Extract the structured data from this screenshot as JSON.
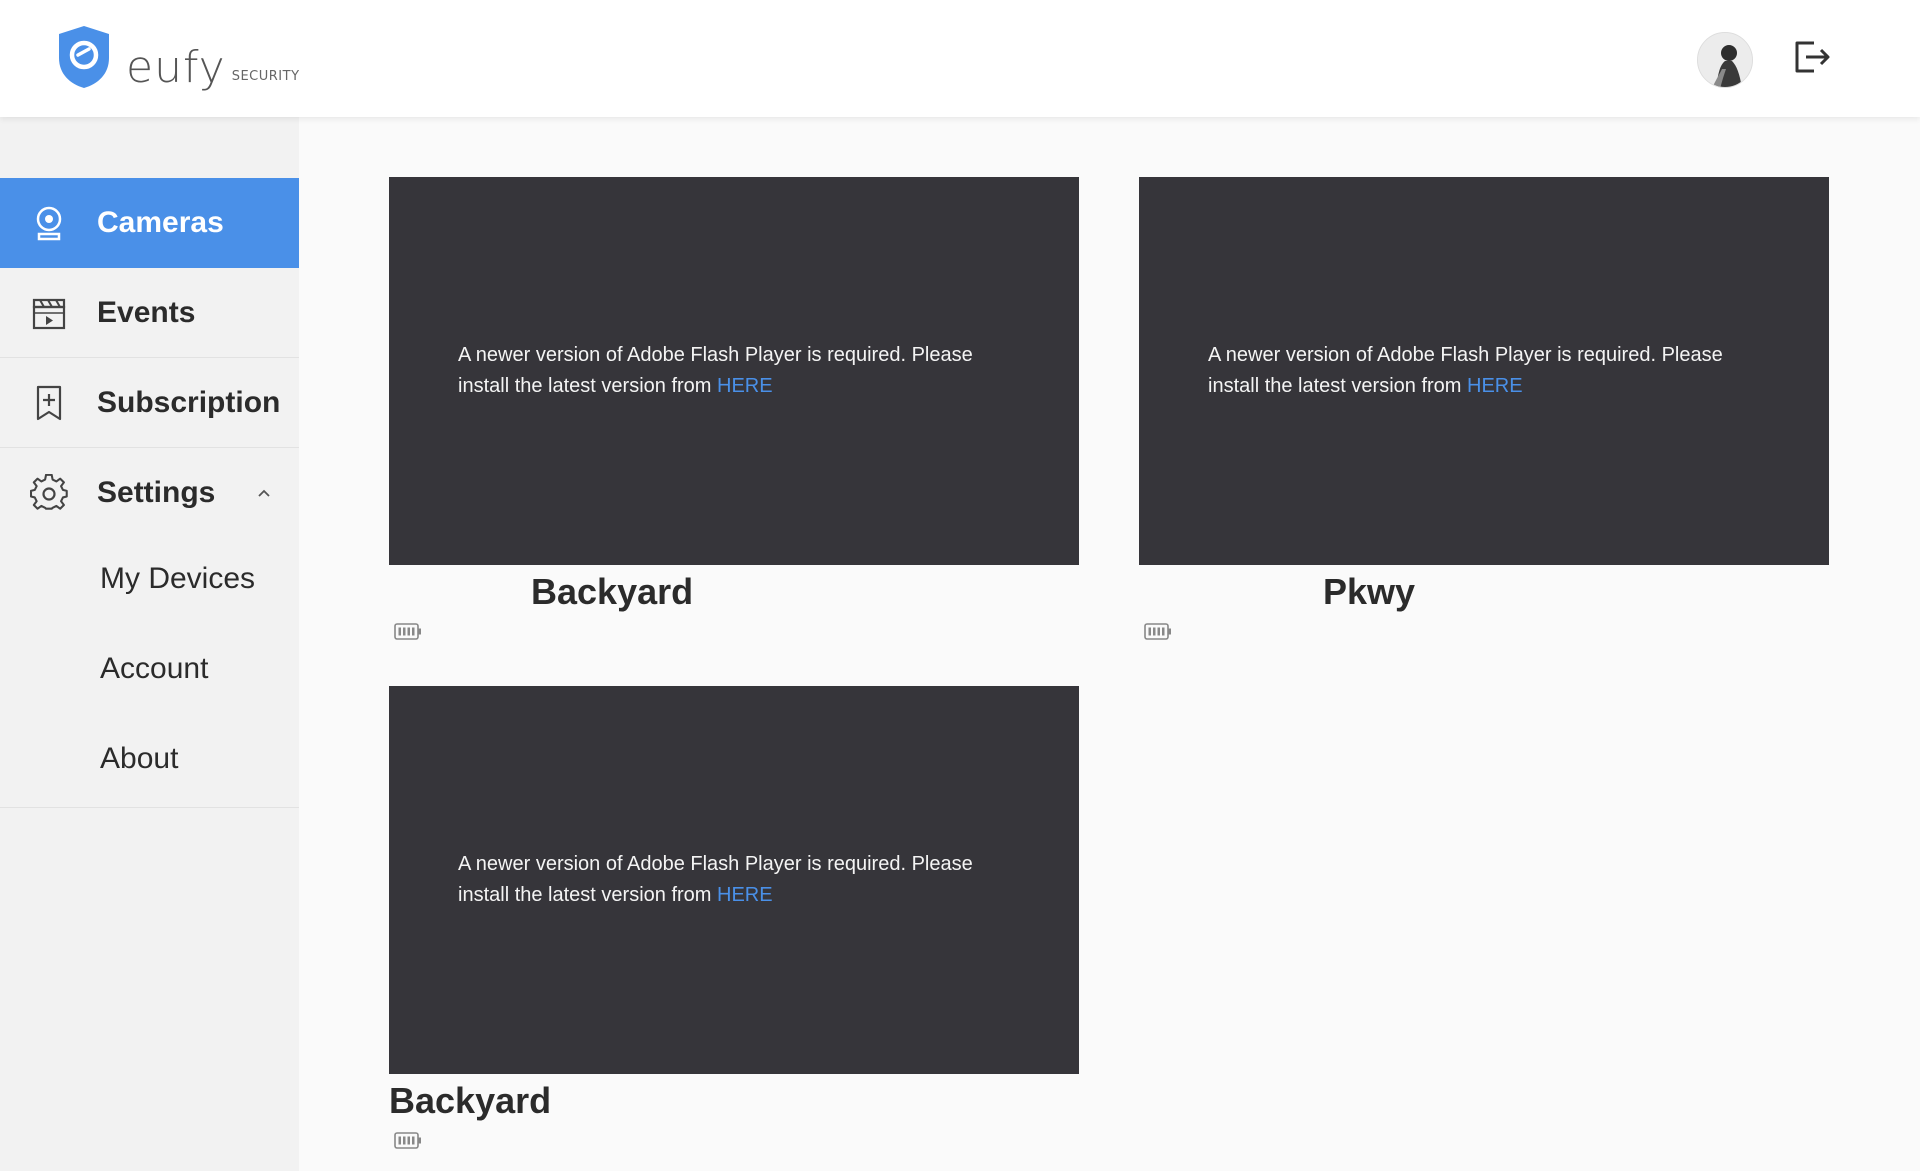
{
  "header": {
    "logo_word": "eufy",
    "logo_sub": "SECURITY",
    "avatar_icon": "user-avatar",
    "logout_icon": "logout-icon"
  },
  "colors": {
    "accent": "#4a90e8",
    "video_bg": "#36353a",
    "sidebar_bg": "#f2f2f2",
    "page_bg": "#fafafa"
  },
  "sidebar": {
    "items": [
      {
        "label": "Cameras",
        "icon": "camera-icon",
        "active": true
      },
      {
        "label": "Events",
        "icon": "clapperboard-icon",
        "active": false
      },
      {
        "label": "Subscription",
        "icon": "bookmark-plus-icon",
        "active": false
      },
      {
        "label": "Settings",
        "icon": "gear-icon",
        "active": false,
        "expanded": true
      }
    ],
    "settings_sub": [
      "My Devices",
      "Account",
      "About"
    ]
  },
  "cameras": [
    {
      "name": "Backyard",
      "message": "A newer version of Adobe Flash Player is required. Please install the latest version from ",
      "link": "HERE",
      "battery_icon": "battery-icon"
    },
    {
      "name": "Pkwy",
      "message": "A newer version of Adobe Flash Player is required. Please install the latest version from ",
      "link": "HERE",
      "battery_icon": "battery-icon"
    },
    {
      "name": "Backyard",
      "message": "A newer version of Adobe Flash Player is required. Please install the latest version from ",
      "link": "HERE",
      "battery_icon": "battery-icon"
    }
  ]
}
